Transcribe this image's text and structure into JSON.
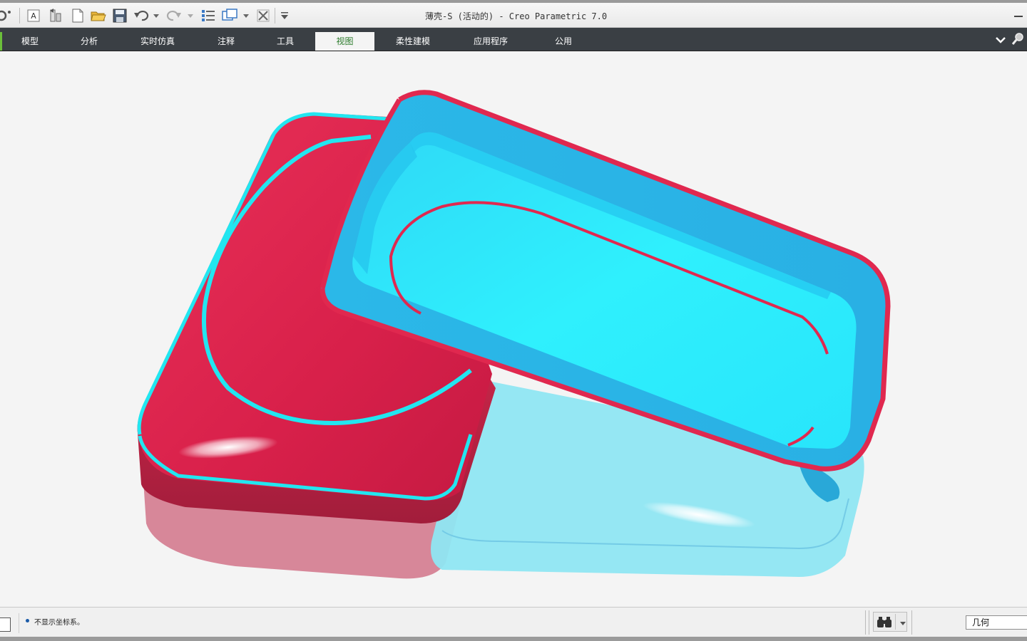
{
  "window": {
    "title": "薄壳-S (活动的) - Creo Parametric 7.0"
  },
  "quick_access": {
    "icons": [
      "settings-icon",
      "annotation-a-icon",
      "regenerate-icon",
      "new-file-icon",
      "open-folder-icon",
      "save-icon",
      "undo-icon",
      "undo-dropdown-icon",
      "redo-icon",
      "redo-dropdown-icon",
      "regenerate-model-icon",
      "window-switch-icon",
      "window-dropdown-icon",
      "close-window-icon",
      "customize-toolbar-icon"
    ]
  },
  "ribbon": {
    "tabs": [
      {
        "label": "模型"
      },
      {
        "label": "分析"
      },
      {
        "label": "实时仿真"
      },
      {
        "label": "注释"
      },
      {
        "label": "工具"
      },
      {
        "label": "视图"
      },
      {
        "label": "柔性建模"
      },
      {
        "label": "应用程序"
      },
      {
        "label": "公用"
      }
    ],
    "active_tab": "视图",
    "accent_color": "#6bbf3a"
  },
  "graphics": {
    "background": "#f4f4f4",
    "red_part_color": "#e0284f",
    "cyan_part_color": "#2ee8fb",
    "edge_highlight_color": "#22e6f0"
  },
  "status": {
    "message": "不显示坐标系。",
    "filter_value": "几何"
  }
}
